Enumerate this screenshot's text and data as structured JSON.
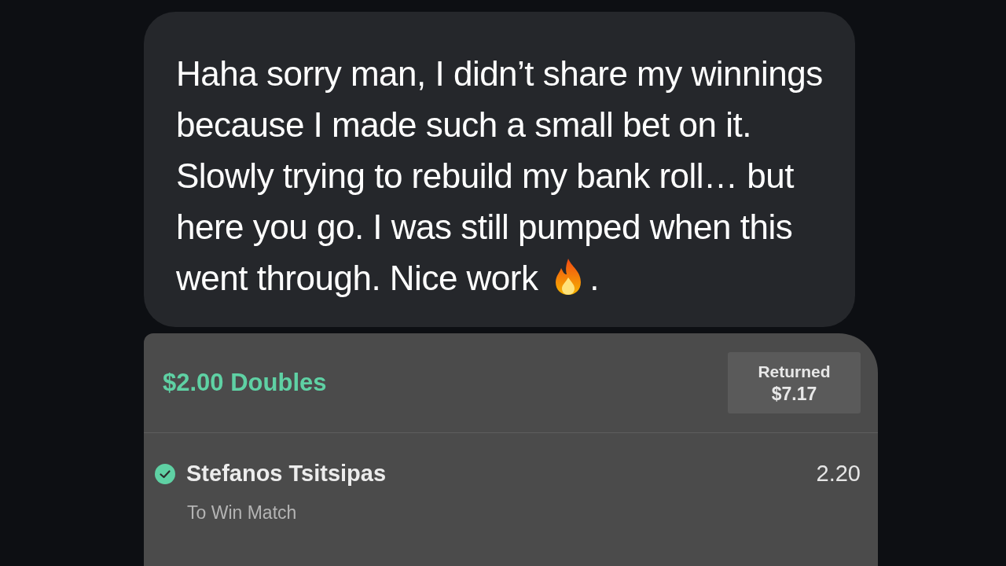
{
  "message": {
    "text": "Haha sorry man, I didn’t share my winnings because I made such a small bet on it. Slowly trying to rebuild my bank roll… but here you go. I was still pumped when this went through. Nice work",
    "trailing": "."
  },
  "bet_card": {
    "title": "$2.00 Doubles",
    "returned_label": "Returned",
    "returned_amount": "$7.17",
    "legs": [
      {
        "selection": "Stefanos Tsitsipas",
        "market": "To Win Match",
        "odds": "2.20",
        "won": true
      }
    ]
  }
}
